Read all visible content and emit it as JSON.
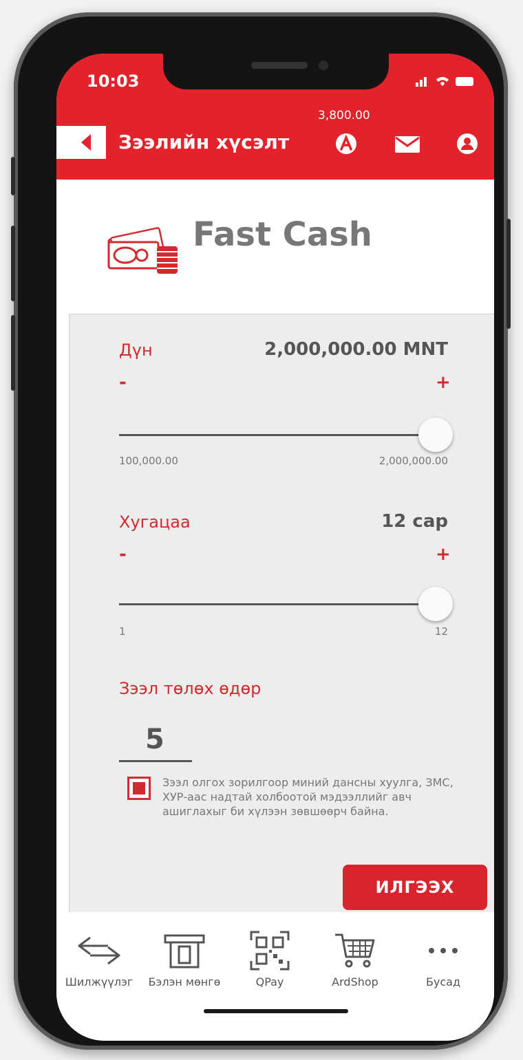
{
  "status_bar": {
    "time": "10:03",
    "icons_text": "..ıl ᯤ ▬"
  },
  "header": {
    "title": "Зээлийн хүсэлт",
    "balance": "3,800.00",
    "colors": {
      "accent": "#e4222b"
    },
    "icons": [
      "back-arrow-icon",
      "points-icon",
      "mail-icon",
      "user-icon"
    ]
  },
  "brand": {
    "name": "Fast Cash",
    "logo_icon": "cash-coins-icon"
  },
  "amount": {
    "label": "Дүн",
    "value": "2,000,000.00 MNT",
    "minus": "-",
    "plus": "+",
    "min": "100,000.00",
    "max": "2,000,000.00",
    "level": 1.0
  },
  "term": {
    "label": "Хугацаа",
    "value": "12 сар",
    "minus": "-",
    "plus": "+",
    "min": "1",
    "max": "12",
    "level": 1.0
  },
  "payday": {
    "label": "Зээл төлөх өдөр",
    "value": "5"
  },
  "consent": {
    "checked": true,
    "text": "Зээл олгох зорилгоор миний дансны хуулга, ЗМС, ХУР-аас надтай холбоотой мэдээллийг авч ашиглахыг би хүлээн зөвшөөрч байна."
  },
  "submit_label": "ИЛГЭЭХ",
  "bottom_nav": [
    {
      "label": "Шилжүүлэг",
      "icon": "transfer-arrows-icon"
    },
    {
      "label": "Бэлэн мөнгө",
      "icon": "atm-icon"
    },
    {
      "label": "QPay",
      "icon": "qr-code-icon"
    },
    {
      "label": "ArdShop",
      "icon": "cart-icon"
    },
    {
      "label": "Бусад",
      "icon": "more-dots-icon"
    }
  ]
}
